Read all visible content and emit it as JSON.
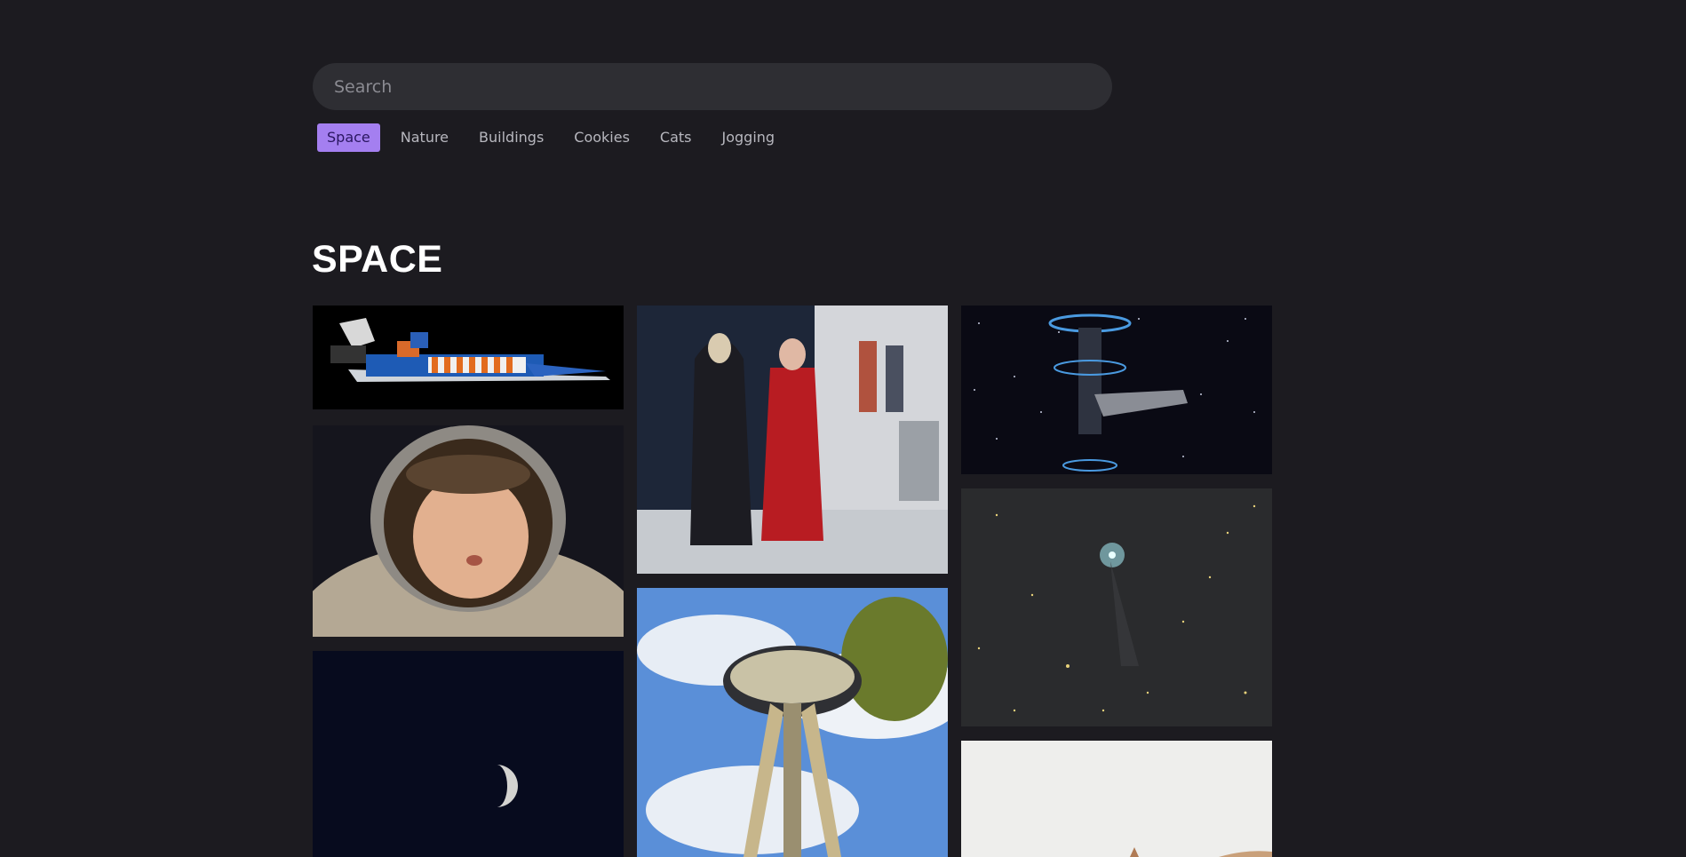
{
  "search": {
    "placeholder": "Search",
    "value": ""
  },
  "tabs": [
    {
      "label": "Space",
      "active": true
    },
    {
      "label": "Nature",
      "active": false
    },
    {
      "label": "Buildings",
      "active": false
    },
    {
      "label": "Cookies",
      "active": false
    },
    {
      "label": "Cats",
      "active": false
    },
    {
      "label": "Jogging",
      "active": false
    }
  ],
  "section": {
    "title": "SPACE"
  },
  "gallery": {
    "images": [
      "lego-spaceship-photo",
      "costumed-figures-photo",
      "space-station-photo",
      "baby-astronaut-photo",
      "space-needle-photo",
      "comet-starfield-photo",
      "moon-night-sky-photo",
      "rock-formation-photo"
    ]
  },
  "colors": {
    "accent": "#a47ff0",
    "background": "#1c1b20",
    "search_bg": "#2e2e33"
  }
}
